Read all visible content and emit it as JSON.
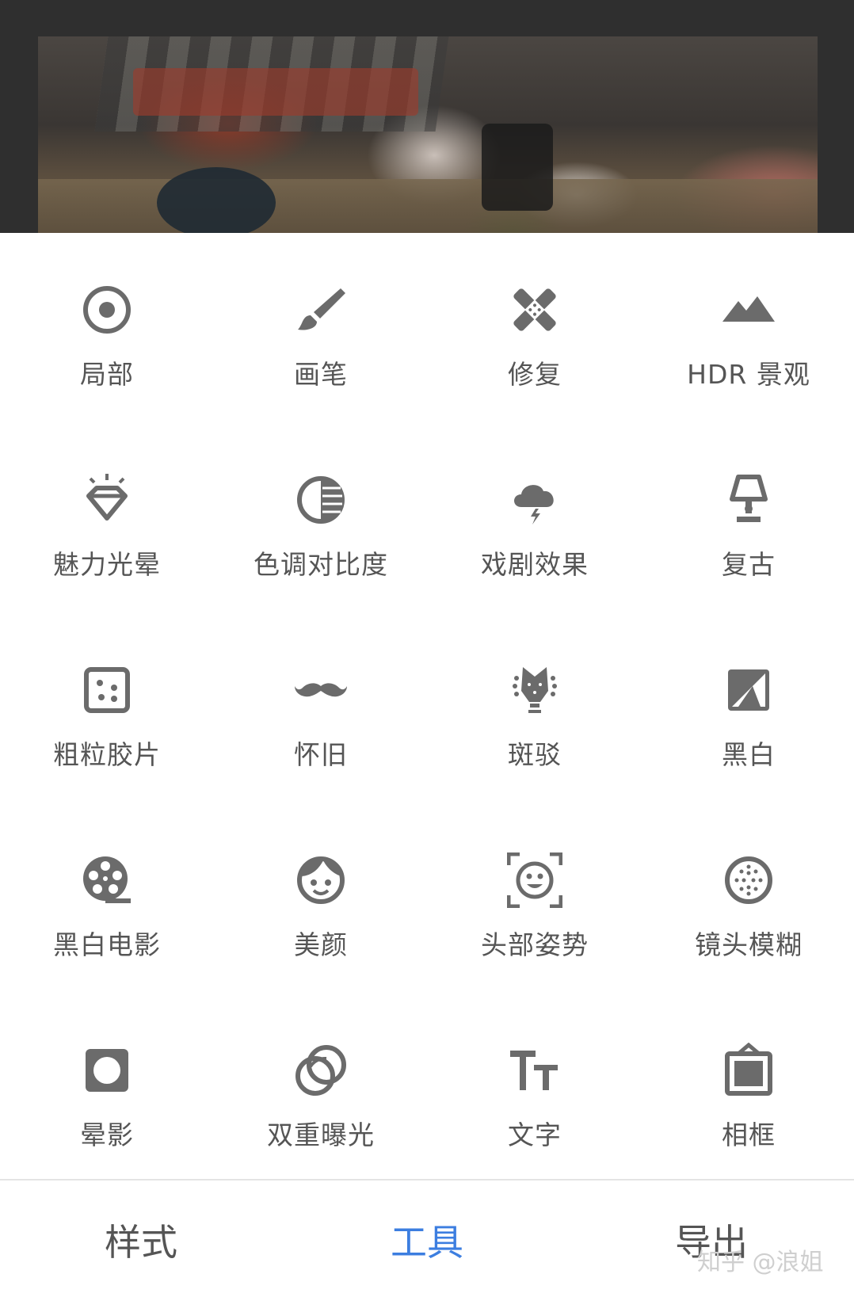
{
  "tools": [
    {
      "label": "局部",
      "icon": "target-icon"
    },
    {
      "label": "画笔",
      "icon": "brush-icon"
    },
    {
      "label": "修复",
      "icon": "bandage-icon"
    },
    {
      "label": "HDR 景观",
      "icon": "mountains-icon"
    },
    {
      "label": "魅力光晕",
      "icon": "diamond-glow-icon"
    },
    {
      "label": "色调对比度",
      "icon": "half-circle-contrast-icon"
    },
    {
      "label": "戏剧效果",
      "icon": "storm-cloud-icon"
    },
    {
      "label": "复古",
      "icon": "lamp-icon"
    },
    {
      "label": "粗粒胶片",
      "icon": "grain-dots-icon"
    },
    {
      "label": "怀旧",
      "icon": "mustache-icon"
    },
    {
      "label": "斑驳",
      "icon": "guitar-head-icon"
    },
    {
      "label": "黑白",
      "icon": "bw-square-icon"
    },
    {
      "label": "黑白电影",
      "icon": "film-reel-icon"
    },
    {
      "label": "美颜",
      "icon": "face-icon"
    },
    {
      "label": "头部姿势",
      "icon": "face-frame-icon"
    },
    {
      "label": "镜头模糊",
      "icon": "blur-dots-icon"
    },
    {
      "label": "晕影",
      "icon": "vignette-icon"
    },
    {
      "label": "双重曝光",
      "icon": "double-circles-icon"
    },
    {
      "label": "文字",
      "icon": "text-tt-icon"
    },
    {
      "label": "相框",
      "icon": "frame-icon"
    }
  ],
  "nav": {
    "styles": "样式",
    "tools": "工具",
    "export": "导出",
    "active": "tools"
  },
  "watermark": "知乎 @浪姐",
  "colors": {
    "icon": "#6b6b6b",
    "label": "#555555",
    "active": "#3c7ee0"
  }
}
